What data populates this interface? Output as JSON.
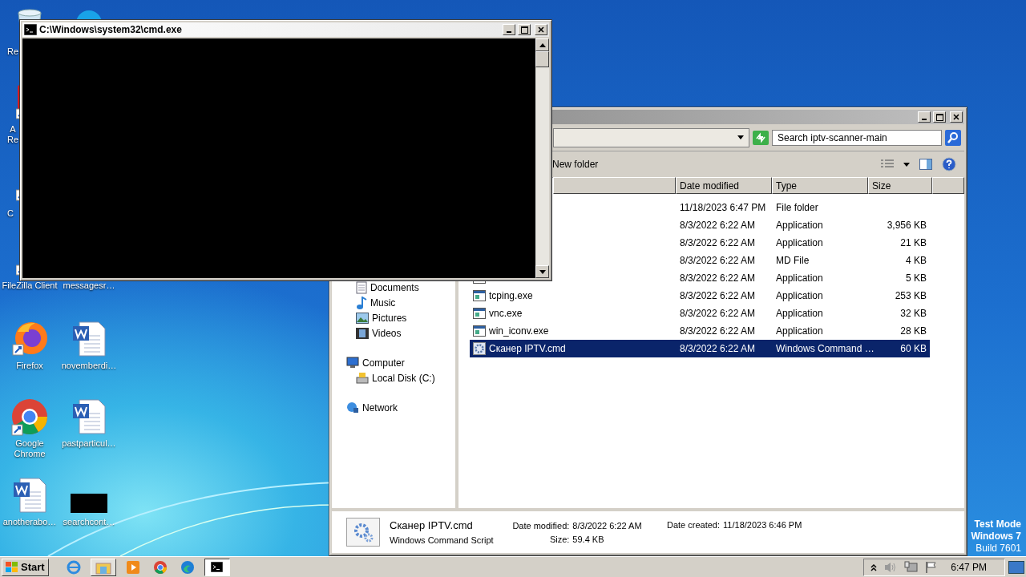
{
  "desktop": {
    "icons": [
      {
        "label": "Re",
        "kind": "recycle"
      },
      {
        "kind": "blue"
      },
      {
        "label": "A\nRe",
        "kind": "pdf"
      },
      {
        "label": "C",
        "kind": "shortcut"
      },
      {
        "label": "FileZilla Client",
        "kind": "filezilla"
      },
      {
        "label": "messagesr…"
      },
      {
        "label": "Firefox",
        "kind": "firefox"
      },
      {
        "label": "novemberdi…",
        "kind": "word"
      },
      {
        "label": "Google Chrome",
        "kind": "chrome"
      },
      {
        "label": "pastparticul…",
        "kind": "word"
      },
      {
        "label": "anotherabo…",
        "kind": "word"
      },
      {
        "label": "searchcont…",
        "kind": "black"
      }
    ],
    "test_mode": [
      "Test Mode",
      "Windows 7",
      "Build 7601"
    ]
  },
  "cmd": {
    "title": "C:\\Windows\\system32\\cmd.exe"
  },
  "explorer": {
    "search": {
      "placeholder": "Search iptv-scanner-main"
    },
    "toolbar": [
      "New folder"
    ],
    "columns": [
      "Date modified",
      "Type",
      "Size"
    ],
    "nav": [
      {
        "children": [
          {
            "label": "Documents",
            "kind": "documents"
          },
          {
            "label": "Music",
            "kind": "music"
          },
          {
            "label": "Pictures",
            "kind": "pictures"
          },
          {
            "label": "Videos",
            "kind": "videos"
          }
        ]
      },
      {
        "label": "Computer",
        "kind": "computer",
        "children": [
          {
            "label": "Local Disk (C:)",
            "kind": "disk"
          }
        ]
      },
      {
        "label": "Network",
        "kind": "network"
      }
    ],
    "files": [
      {
        "modified": "11/18/2023 6:47 PM",
        "type": "File folder",
        "selected": false
      },
      {
        "modified": "8/3/2022 6:22 AM",
        "type": "Application",
        "size": "3,956 KB",
        "selected": false
      },
      {
        "modified": "8/3/2022 6:22 AM",
        "type": "Application",
        "size": "21 KB",
        "selected": false
      },
      {
        "modified": "8/3/2022 6:22 AM",
        "type": "MD File",
        "size": "4 KB",
        "selected": false
      },
      {
        "kind": "exe",
        "modified": "8/3/2022 6:22 AM",
        "type": "Application",
        "size": "5 KB",
        "selected": false
      },
      {
        "kind": "exe",
        "name": "tcping.exe",
        "modified": "8/3/2022 6:22 AM",
        "type": "Application",
        "size": "253 KB",
        "selected": false
      },
      {
        "kind": "exe",
        "name": "vnc.exe",
        "modified": "8/3/2022 6:22 AM",
        "type": "Application",
        "size": "32 KB",
        "selected": false
      },
      {
        "kind": "exe",
        "name": "win_iconv.exe",
        "modified": "8/3/2022 6:22 AM",
        "type": "Application",
        "size": "28 KB",
        "selected": false
      },
      {
        "kind": "cmd",
        "name": "Сканер IPTV.cmd",
        "modified": "8/3/2022 6:22 AM",
        "type": "Windows Command …",
        "size": "60 KB",
        "selected": true
      }
    ],
    "details": {
      "name": "Сканер IPTV.cmd",
      "type": "Windows Command Script",
      "modified_label": "Date modified:",
      "modified": "8/3/2022 6:22 AM",
      "size_label": "Size:",
      "size": "59.4 KB",
      "created_label": "Date created:",
      "created": "11/18/2023 6:46 PM"
    }
  },
  "taskbar": {
    "start": "Start",
    "apps": [
      {
        "kind": "ie",
        "open": false,
        "selected": false
      },
      {
        "kind": "explorer",
        "open": true,
        "selected": false
      },
      {
        "kind": "media",
        "open": false,
        "selected": false
      },
      {
        "kind": "chrome",
        "open": false,
        "selected": false
      },
      {
        "kind": "edge",
        "open": false,
        "selected": false
      },
      {
        "kind": "cmd",
        "open": true,
        "selected": true
      }
    ],
    "clock": "6:47 PM"
  }
}
